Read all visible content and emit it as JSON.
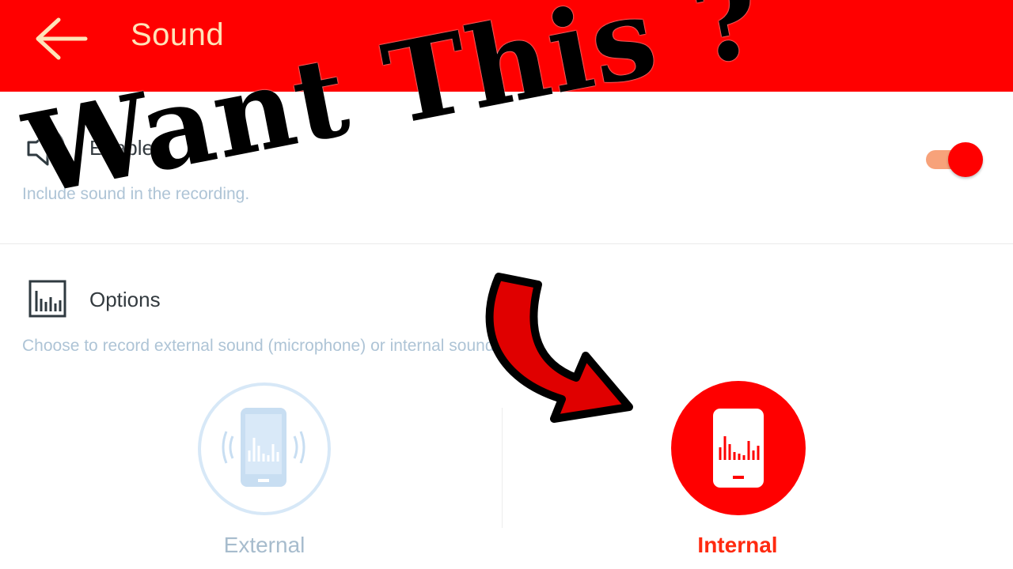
{
  "appbar": {
    "title": "Sound",
    "back_icon": "arrow-left-icon",
    "color": "#ff0000",
    "title_color": "#ffe3b8"
  },
  "sound_enabled": {
    "icon": "speaker-icon",
    "title": "Enabled",
    "description": "Include sound in the recording.",
    "toggle_on": true
  },
  "options": {
    "icon": "equalizer-icon",
    "title": "Options",
    "description": "Choose to record external sound (microphone) or internal sound (app)."
  },
  "sound_sources": [
    {
      "label": "External",
      "icon": "phone-soundwave-icon",
      "selected": false
    },
    {
      "label": "Internal",
      "icon": "phone-soundwave-icon",
      "selected": true
    }
  ],
  "overlay": {
    "text": "Want This ?",
    "arrow_icon": "curved-arrow-icon"
  },
  "colors": {
    "accent": "#ff0000",
    "inactive": "#c8def2",
    "description": "#aec4d6"
  }
}
